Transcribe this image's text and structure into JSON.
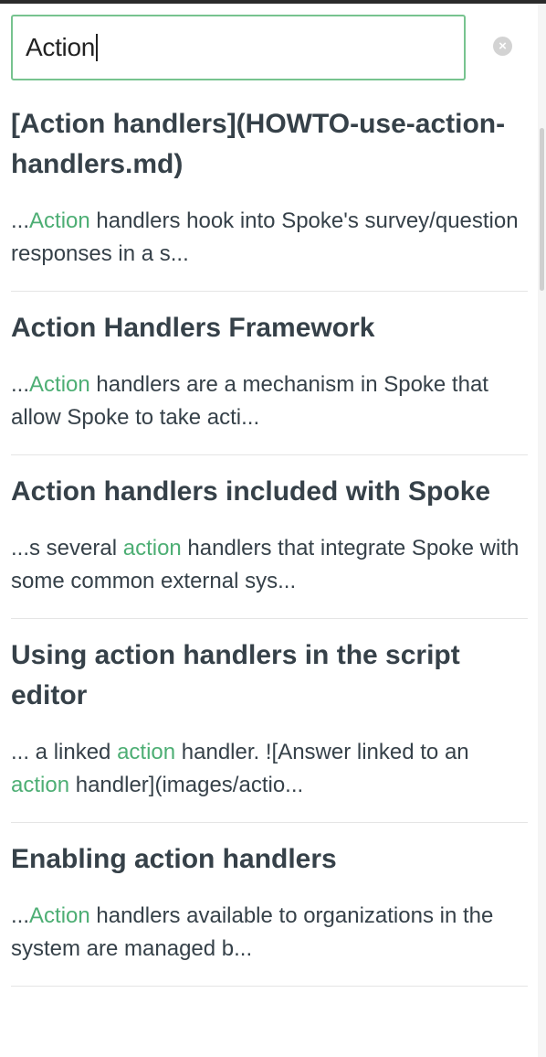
{
  "search": {
    "value": "Action",
    "clear_icon": "close-circle-icon"
  },
  "results": [
    {
      "title": "[Action handlers](HOWTO-use-action-handlers.md)",
      "snippet": [
        {
          "text": "...",
          "hl": false
        },
        {
          "text": "Action",
          "hl": true
        },
        {
          "text": " handlers hook into Spoke's survey/question responses in a s...",
          "hl": false
        }
      ]
    },
    {
      "title": "Action Handlers Framework",
      "snippet": [
        {
          "text": "...",
          "hl": false
        },
        {
          "text": "Action",
          "hl": true
        },
        {
          "text": " handlers are a mechanism in Spoke that allow Spoke to take acti...",
          "hl": false
        }
      ]
    },
    {
      "title": "Action handlers included with Spoke",
      "snippet": [
        {
          "text": "...s several ",
          "hl": false
        },
        {
          "text": "action",
          "hl": true
        },
        {
          "text": " handlers that integrate Spoke with some common external sys...",
          "hl": false
        }
      ]
    },
    {
      "title": "Using action handlers in the script editor",
      "snippet": [
        {
          "text": "... a linked ",
          "hl": false
        },
        {
          "text": "action",
          "hl": true
        },
        {
          "text": " handler. ![Answer linked to an ",
          "hl": false
        },
        {
          "text": "action",
          "hl": true
        },
        {
          "text": " handler](images/actio...",
          "hl": false
        }
      ]
    },
    {
      "title": "Enabling action handlers",
      "snippet": [
        {
          "text": "...",
          "hl": false
        },
        {
          "text": "Action",
          "hl": true
        },
        {
          "text": " handlers available to organizations in the system are managed b...",
          "hl": false
        }
      ]
    }
  ],
  "colors": {
    "highlight": "#4dae74",
    "input_border": "#77c38f",
    "text": "#364149"
  }
}
